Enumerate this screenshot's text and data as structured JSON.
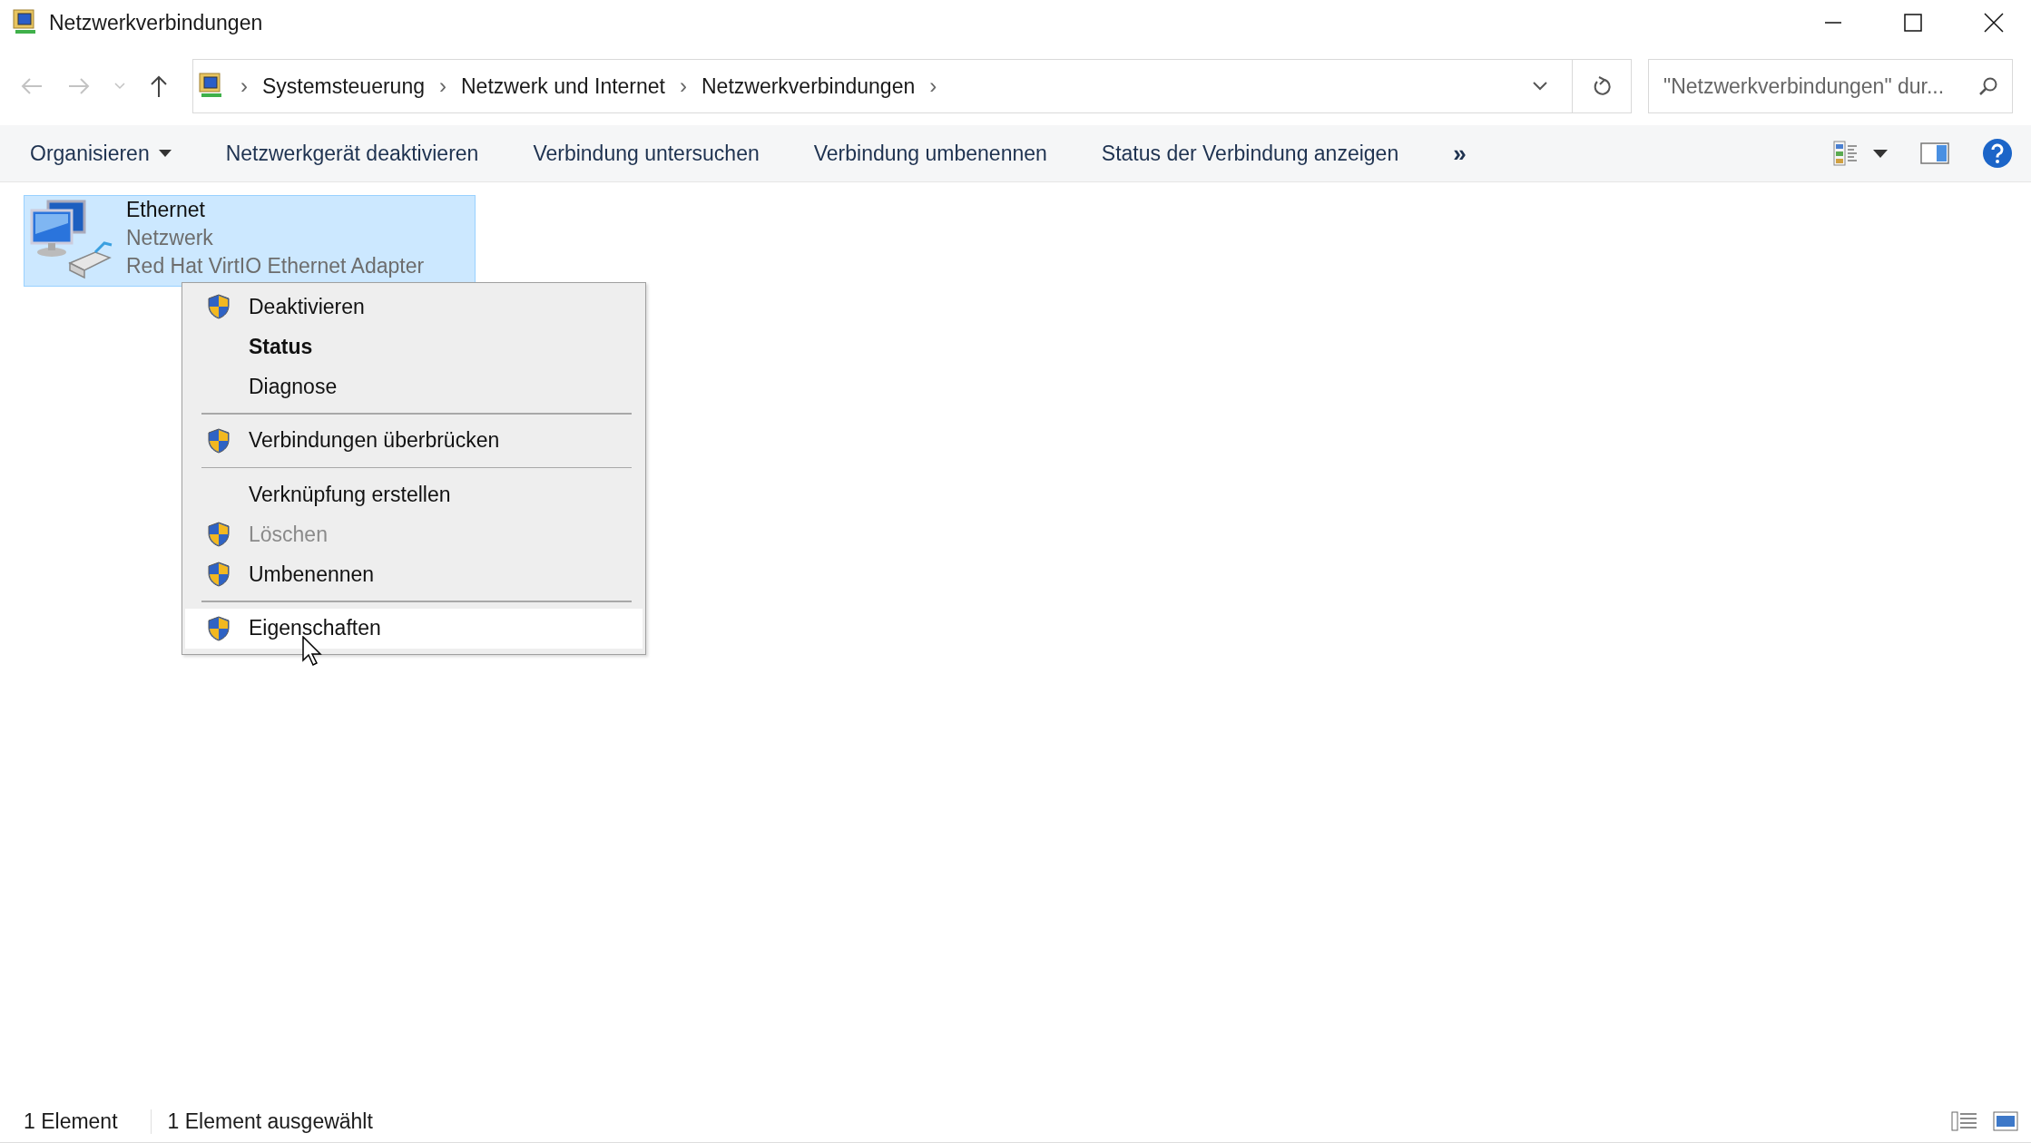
{
  "window": {
    "title": "Netzwerkverbindungen"
  },
  "address": {
    "crumbs": [
      "Systemsteuerung",
      "Netzwerk und Internet",
      "Netzwerkverbindungen"
    ],
    "separator": "›"
  },
  "search": {
    "placeholder": "\"Netzwerkverbindungen\" dur..."
  },
  "toolbar": {
    "items": [
      {
        "label": "Organisieren",
        "dropdown": true
      },
      {
        "label": "Netzwerkgerät deaktivieren",
        "dropdown": false
      },
      {
        "label": "Verbindung untersuchen",
        "dropdown": false
      },
      {
        "label": "Verbindung umbenennen",
        "dropdown": false
      },
      {
        "label": "Status der Verbindung anzeigen",
        "dropdown": false
      }
    ],
    "more": "»"
  },
  "items": [
    {
      "name": "Ethernet",
      "network": "Netzwerk",
      "adapter": "Red Hat VirtIO Ethernet Adapter",
      "selected": true
    }
  ],
  "context_menu": [
    {
      "kind": "item",
      "label": "Deaktivieren",
      "shield": true,
      "default": false,
      "disabled": false,
      "selected": false
    },
    {
      "kind": "item",
      "label": "Status",
      "shield": false,
      "default": true,
      "disabled": false,
      "selected": false
    },
    {
      "kind": "item",
      "label": "Diagnose",
      "shield": false,
      "default": false,
      "disabled": false,
      "selected": false
    },
    {
      "kind": "separator"
    },
    {
      "kind": "item",
      "label": "Verbindungen überbrücken",
      "shield": true,
      "default": false,
      "disabled": false,
      "selected": false
    },
    {
      "kind": "separator"
    },
    {
      "kind": "item",
      "label": "Verknüpfung erstellen",
      "shield": false,
      "default": false,
      "disabled": false,
      "selected": false
    },
    {
      "kind": "item",
      "label": "Löschen",
      "shield": true,
      "default": false,
      "disabled": true,
      "selected": false
    },
    {
      "kind": "item",
      "label": "Umbenennen",
      "shield": true,
      "default": false,
      "disabled": false,
      "selected": false
    },
    {
      "kind": "separator"
    },
    {
      "kind": "item",
      "label": "Eigenschaften",
      "shield": true,
      "default": false,
      "disabled": false,
      "selected": true
    }
  ],
  "status_bar": {
    "count": "1 Element",
    "selection": "1 Element ausgewählt"
  }
}
